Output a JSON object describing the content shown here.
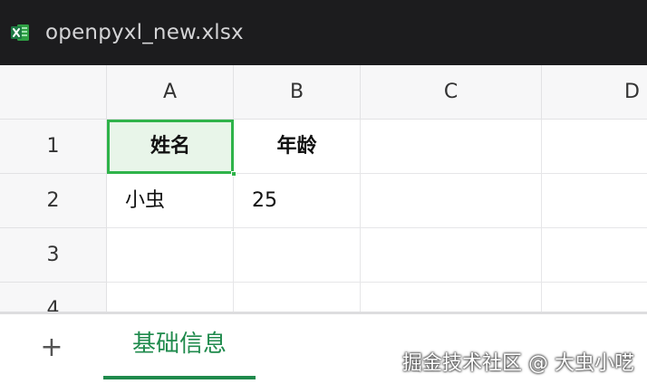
{
  "window": {
    "title": "openpyxl_new.xlsx",
    "app_icon": "excel-icon",
    "icon_color": "#1d7a44"
  },
  "grid": {
    "columns": [
      "A",
      "B",
      "C",
      "D"
    ],
    "rows": [
      "1",
      "2",
      "3",
      "4"
    ],
    "cells": {
      "A1": "姓名",
      "B1": "年龄",
      "A2": "小虫",
      "B2": "25"
    },
    "selected_cell": "A1",
    "selection_color": "#2fb34a"
  },
  "tabs": {
    "add_label": "+",
    "items": [
      {
        "label": "基础信息",
        "active": true
      }
    ],
    "active_color": "#1f8a4c"
  },
  "watermark": "掘金技术社区 @ 大虫小呓"
}
